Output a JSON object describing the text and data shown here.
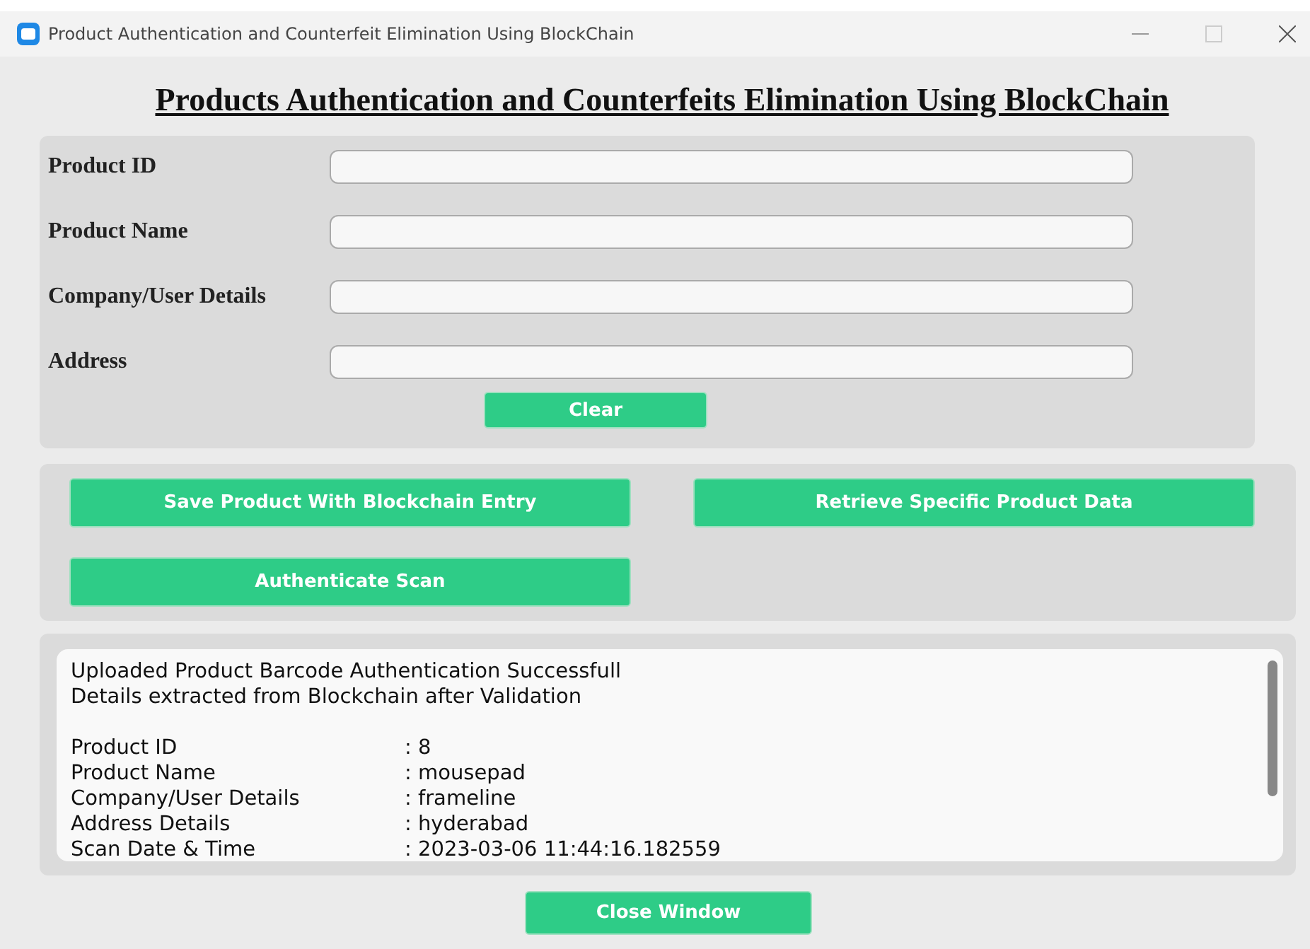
{
  "window": {
    "title": "Product Authentication and Counterfeit Elimination Using BlockChain"
  },
  "heading": "Products Authentication and Counterfeits Elimination Using BlockChain",
  "form": {
    "fields": [
      {
        "label": "Product ID"
      },
      {
        "label": "Product Name"
      },
      {
        "label": "Company/User Details"
      },
      {
        "label": "Address"
      }
    ],
    "clear_button": "Clear"
  },
  "actions": [
    "Save Product With Blockchain Entry",
    "Retrieve Specific Product Data",
    "Authenticate Scan"
  ],
  "output": {
    "lines": [
      "Uploaded Product Barcode Authentication Successfull",
      "Details extracted from Blockchain after Validation"
    ],
    "details": [
      {
        "label": "Product ID",
        "value": ": 8"
      },
      {
        "label": "Product Name",
        "value": ": mousepad"
      },
      {
        "label": "Company/User Details",
        "value": ": frameline"
      },
      {
        "label": "Address Details",
        "value": ": hyderabad"
      },
      {
        "label": "Scan Date & Time",
        "value": ": 2023-03-06 11:44:16.182559"
      }
    ]
  },
  "close_button": "Close Window"
}
